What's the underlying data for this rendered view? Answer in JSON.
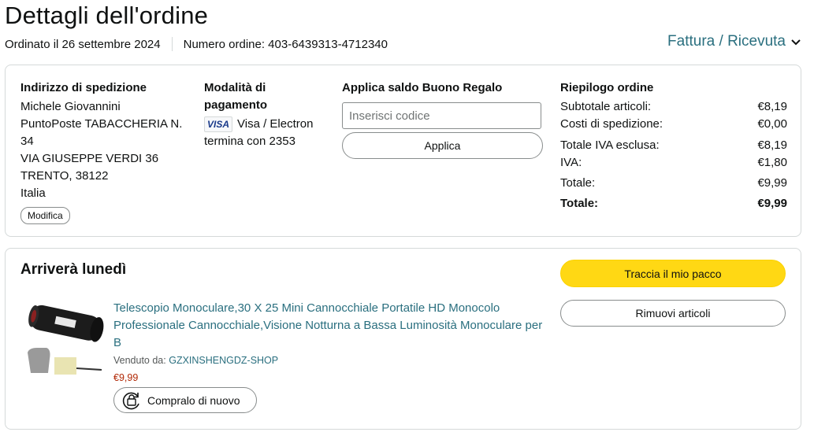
{
  "page": {
    "title": "Dettagli dell'ordine",
    "order_date": "Ordinato il 26 settembre 2024",
    "order_number": "Numero ordine: 403-6439313-4712340",
    "invoice_link": "Fattura / Ricevuta",
    "invoice_icon": "chevron-down-icon"
  },
  "shipping": {
    "heading": "Indirizzo di spedizione",
    "lines": [
      "Michele Giovannini",
      "PuntoPoste TABACCHERIA N. 34",
      "VIA GIUSEPPE VERDI 36",
      "TRENTO, 38122",
      "Italia"
    ],
    "modify_label": "Modifica"
  },
  "payment": {
    "heading": "Modalità di pagamento",
    "card_logo": "VISA",
    "card_type": "Visa / Electron",
    "card_ending": "termina con 2353"
  },
  "gift": {
    "heading": "Applica saldo Buono Regalo",
    "input_placeholder": "Inserisci codice",
    "apply_label": "Applica"
  },
  "summary": {
    "heading": "Riepilogo ordine",
    "rows": [
      {
        "label": "Subtotale articoli:",
        "value": "€8,19"
      },
      {
        "label": "Costi di spedizione:",
        "value": "€0,00"
      },
      {
        "label": "Totale IVA esclusa:",
        "value": "€8,19"
      },
      {
        "label": "IVA:",
        "value": "€1,80"
      },
      {
        "label": "Totale:",
        "value": "€9,99"
      },
      {
        "label": "Totale:",
        "value": "€9,99"
      }
    ]
  },
  "shipment": {
    "arrival": "Arriverà lunedì",
    "track_label": "Traccia il mio pacco",
    "remove_label": "Rimuovi articoli",
    "product_title": "Telescopio Monoculare,30 X 25 Mini Cannocchiale Portatile HD Monocolo Professionale Cannocchiale,Visione Notturna a Bassa Luminosità Monoculare per B",
    "sold_by_label": "Venduto da:",
    "seller": "GZXINSHENGDZ-SHOP",
    "price": "€9,99",
    "buy_again_label": "Compralo di nuovo",
    "buy_again_icon": "buy-again-icon",
    "accent_color": "#ffd814",
    "link_color": "#2a6f7f",
    "price_color": "#b12704"
  }
}
